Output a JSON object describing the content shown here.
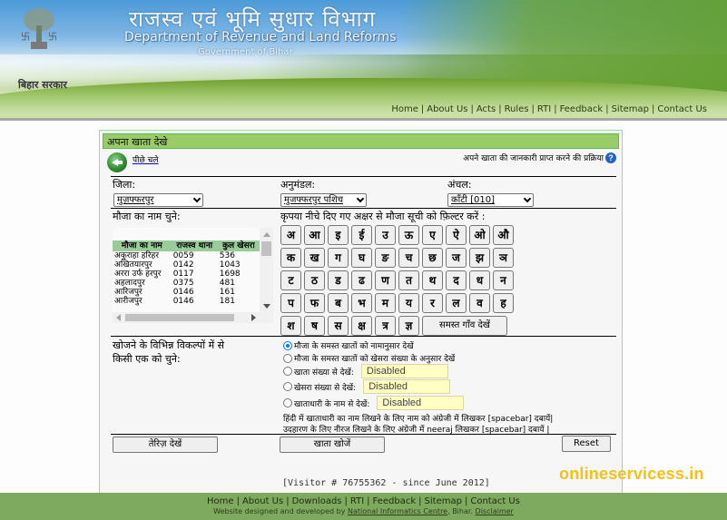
{
  "header": {
    "title_hindi": "राजस्व एवं भूमि सुधार विभाग",
    "title_english": "Department of Revenue and Land Reforms",
    "subtitle": "Government of Bihar",
    "logo_text": "बिहार सरकार",
    "nav": [
      "Home",
      "About Us",
      "Acts",
      "Rules",
      "RTI",
      "Feedback",
      "Sitemap",
      "Contact Us"
    ]
  },
  "panel": {
    "title": "अपना खाता देखे",
    "back_label": "पीछे चले",
    "help_label": "अपने खाता की जानकारी प्राप्त करने की प्रक्रिया",
    "district_label": "जिला:",
    "district_value": "मुज़फ्फरपुर",
    "subdivision_label": "अनुमंडल:",
    "subdivision_value": "मुजफ्फरपुर पशिच",
    "circle_label": "अंचल:",
    "circle_value": "कॉंटी [010]",
    "mauza_label": "मौजा का नाम चुने:",
    "filter_label": "कृपया नीचे दिए गए अक्षर से मौजा सूची को फ़िल्टर करें :",
    "mauza_table": {
      "headers": [
        "मौजा का नाम",
        "राजस्व थाना",
        "कुल खेसरा"
      ],
      "rows": [
        [
          "अकुराहा हरिहर",
          "0059",
          "536"
        ],
        [
          "अखितयारपुर",
          "0142",
          "1043"
        ],
        [
          "अररा उर्फ हरपुर",
          "0117",
          "1698"
        ],
        [
          "अहलादपुर",
          "0375",
          "481"
        ],
        [
          "आरिजपुर",
          "0146",
          "161"
        ],
        [
          "आरीजपुर",
          "0146",
          "181"
        ]
      ]
    },
    "letters": [
      [
        "अ",
        "आ",
        "इ",
        "ई",
        "उ",
        "ऊ",
        "ए",
        "ऐ",
        "ओ",
        "औ"
      ],
      [
        "क",
        "ख",
        "ग",
        "घ",
        "ङ",
        "च",
        "छ",
        "ज",
        "झ",
        "ञ"
      ],
      [
        "ट",
        "ठ",
        "ड",
        "ढ",
        "ण",
        "त",
        "थ",
        "द",
        "ध",
        "न"
      ],
      [
        "प",
        "फ",
        "ब",
        "भ",
        "म",
        "य",
        "र",
        "ल",
        "व",
        "ह"
      ],
      [
        "श",
        "ष",
        "स",
        "क्ष",
        "त्र",
        "ज्ञ"
      ]
    ],
    "all_villages_button": "समस्त गाँव देखें",
    "options_label_line1": "खोजने के विभिन्न विकल्पों में से",
    "options_label_line2": "किसी एक को चुने:",
    "options": [
      {
        "label": "मौजा के समस्त खातों को नामानुसार देखें",
        "selected": true
      },
      {
        "label": "मौजा के समस्त खातों को खेसरा संख्या के अनुसार देखें",
        "selected": false
      },
      {
        "label": "खाता संख्या से देखें:",
        "selected": false,
        "input_value": "Disabled"
      },
      {
        "label": "खेसरा संख्या से देखें:",
        "selected": false,
        "input_value": "Disabled"
      },
      {
        "label": "खाताधारी के नाम से देखें:",
        "selected": false,
        "input_value": "Disabled"
      }
    ],
    "hint_line1": "हिंदी में खाताधारी का नाम लिखने के लिए नाम को अंग्रेजी में लिखकर [spacebar] दबायें|",
    "hint_line2": "उदहारण के लिए नीरज लिखने के लिए अंग्रेजी में neeraj लिखकर [spacebar] दबायें |",
    "register_button": "तेरिज़ देखें",
    "search_button": "खाता खोजें",
    "reset_button": "Reset"
  },
  "visitor": "[Visitor #  76755362 - since June 2012]",
  "watermark": "onlineservicess.in",
  "footer": {
    "nav": [
      "Home",
      "About Us",
      "Downloads",
      "RTI",
      "Feedback",
      "Sitemap",
      "Contact Us"
    ],
    "credit_prefix": "Website designed and developed by",
    "credit_link": "National Informatics Centre",
    "credit_suffix": ", Bihar.",
    "disclaimer": "Disclaimer"
  },
  "colors": {
    "panel_title_bg": "#99cc66",
    "table_header_bg": "#99cc99",
    "footer_bg": "#7daa5f",
    "disabled_input_bg": "#ffffc4",
    "watermark": "#f4c118"
  }
}
